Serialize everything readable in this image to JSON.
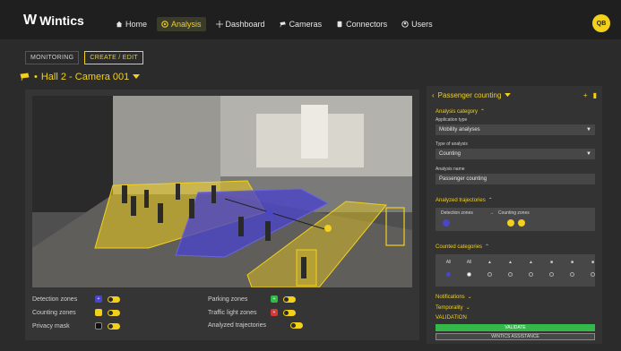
{
  "app": {
    "name": "Wintics",
    "logo_mark": "W"
  },
  "nav": {
    "items": [
      {
        "label": "Home",
        "icon": "home-icon"
      },
      {
        "label": "Analysis",
        "icon": "gear-icon"
      },
      {
        "label": "Dashboard",
        "icon": "dashboard-icon"
      },
      {
        "label": "Cameras",
        "icon": "camera-icon"
      },
      {
        "label": "Connectors",
        "icon": "connector-icon"
      },
      {
        "label": "Users",
        "icon": "users-icon"
      }
    ],
    "active_index": 1
  },
  "user": {
    "initials": "QB"
  },
  "tabs": [
    {
      "label": "MONITORING"
    },
    {
      "label": "CREATE / EDIT"
    }
  ],
  "camera": {
    "title": "Hall 2 - Camera 001"
  },
  "legend": {
    "detection": "Detection zones",
    "counting": "Counting zones",
    "privacy": "Privacy mask",
    "parking": "Parking zones",
    "traffic": "Traffic light zones",
    "trajectories": "Analyzed trajectories"
  },
  "colors": {
    "accent": "#f2d01c",
    "detection": "#4b45c8",
    "counting": "#f2d01c",
    "parking": "#35b84a",
    "traffic": "#d23a3a",
    "validate": "#35b84a"
  },
  "panel": {
    "title": "Passenger counting",
    "analysis_category": "Analysis category",
    "application_type_label": "Application type",
    "application_type_value": "Mobility analyses",
    "type_of_analysis_label": "Type of analysis",
    "type_of_analysis_value": "Counting",
    "analysis_name_label": "Analysis name",
    "analysis_name_value": "Passenger counting",
    "analyzed_trajectories": "Analyzed trajectories",
    "detection_zones": "Detection zones",
    "counting_zones": "Counting zones",
    "counted_categories": "Counted categories",
    "categories": [
      {
        "label": "All"
      },
      {
        "label": "All"
      },
      {
        "label": ""
      },
      {
        "label": ""
      },
      {
        "label": ""
      },
      {
        "label": ""
      },
      {
        "label": ""
      },
      {
        "label": ""
      }
    ],
    "notifications": "Notifications",
    "temporality": "Temporality",
    "validation": "VALIDATION",
    "validate_btn": "VALIDATE",
    "advanced_btn": "WINTICS ASSISTANCE"
  }
}
